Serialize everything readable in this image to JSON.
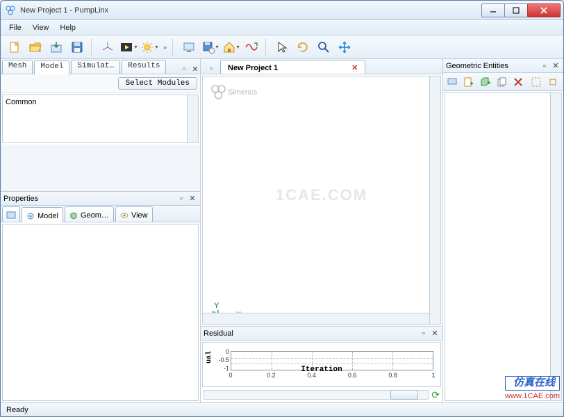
{
  "window": {
    "title": "New Project 1 - PumpLinx"
  },
  "menu": {
    "file": "File",
    "view": "View",
    "help": "Help"
  },
  "left": {
    "tabs": {
      "mesh": "Mesh",
      "model": "Model",
      "simulation": "Simulat…",
      "results": "Results"
    },
    "select_modules": "Select Modules",
    "tree_item": "Common",
    "properties_title": "Properties",
    "prop_tabs": {
      "model": "Model",
      "geom": "Geom…",
      "view": "View"
    }
  },
  "center": {
    "tab": "New Project 1",
    "brand": "Simerics",
    "watermark": "1CAE.COM",
    "axes": {
      "y": "Y",
      "z": "Z",
      "x": "X"
    },
    "residual_title": "Residual"
  },
  "right": {
    "title": "Geometric Entities"
  },
  "status": {
    "text": "Ready"
  },
  "watermark_logo": {
    "line1": "仿真在线",
    "line2": "www.1CAE.com"
  },
  "chart_data": {
    "type": "line",
    "title": "",
    "xlabel": "Iteration",
    "ylabel": "ual",
    "x_ticks": [
      0,
      0.2,
      0.4,
      0.6,
      0.8,
      1
    ],
    "y_ticks": [
      0,
      -0.5,
      -1
    ],
    "xlim": [
      0,
      1
    ],
    "ylim": [
      -1,
      0
    ],
    "series": [
      {
        "name": "Residual",
        "x": [],
        "y": []
      }
    ]
  }
}
